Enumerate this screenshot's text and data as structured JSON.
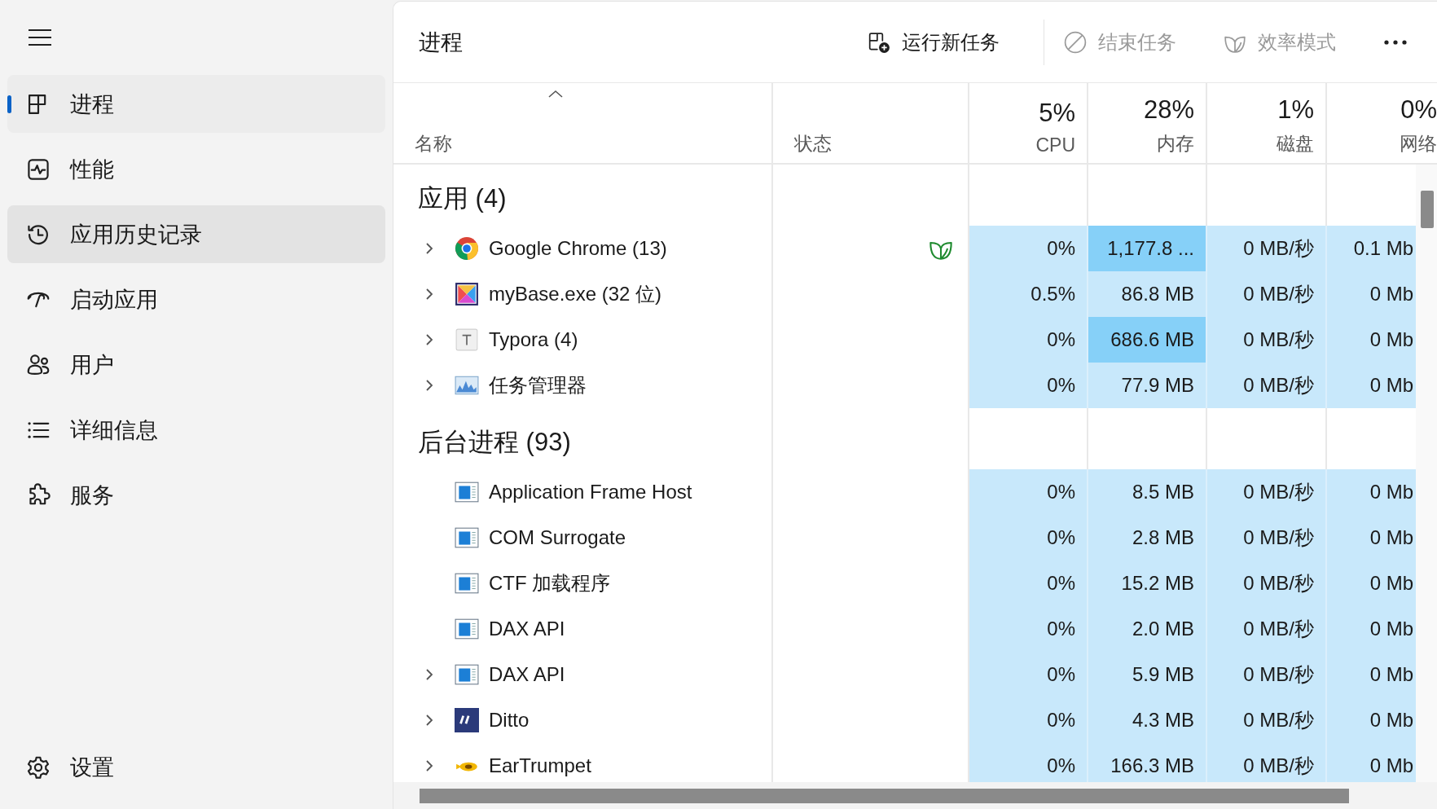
{
  "sidebar": {
    "items": [
      {
        "label": "进程",
        "selected": true,
        "hovered": false
      },
      {
        "label": "性能",
        "selected": false,
        "hovered": false
      },
      {
        "label": "应用历史记录",
        "selected": false,
        "hovered": true
      },
      {
        "label": "启动应用",
        "selected": false,
        "hovered": false
      },
      {
        "label": "用户",
        "selected": false,
        "hovered": false
      },
      {
        "label": "详细信息",
        "selected": false,
        "hovered": false
      },
      {
        "label": "服务",
        "selected": false,
        "hovered": false
      }
    ],
    "footer": {
      "label": "设置"
    }
  },
  "toolbar": {
    "title": "进程",
    "buttons": [
      {
        "label": "运行新任务",
        "disabled": false
      },
      {
        "label": "结束任务",
        "disabled": true
      },
      {
        "label": "效率模式",
        "disabled": true
      }
    ]
  },
  "table": {
    "columns": [
      {
        "label": "名称",
        "sorted": true
      },
      {
        "label": "状态",
        "sorted": false
      },
      {
        "usage": "5%",
        "label": "CPU",
        "sorted": false
      },
      {
        "usage": "28%",
        "label": "内存",
        "sorted": false
      },
      {
        "usage": "1%",
        "label": "磁盘",
        "sorted": false
      },
      {
        "usage": "0%",
        "label": "网络",
        "sorted": false
      }
    ],
    "groups": [
      {
        "title": "应用 (4)",
        "rows": [
          {
            "name": "Google Chrome (13)",
            "expandable": true,
            "efficiency_mode": true,
            "cpu": "0%",
            "memory": "1,177.8 ...",
            "memory_high": true,
            "disk": "0 MB/秒",
            "network": "0.1 Mb"
          },
          {
            "name": "myBase.exe (32 位)",
            "expandable": true,
            "efficiency_mode": false,
            "cpu": "0.5%",
            "memory": "86.8 MB",
            "memory_high": false,
            "disk": "0 MB/秒",
            "network": "0 Mb"
          },
          {
            "name": "Typora (4)",
            "expandable": true,
            "efficiency_mode": false,
            "cpu": "0%",
            "memory": "686.6 MB",
            "memory_high": true,
            "disk": "0 MB/秒",
            "network": "0 Mb"
          },
          {
            "name": "任务管理器",
            "expandable": true,
            "efficiency_mode": false,
            "cpu": "0%",
            "memory": "77.9 MB",
            "memory_high": false,
            "disk": "0 MB/秒",
            "network": "0 Mb"
          }
        ]
      },
      {
        "title": "后台进程 (93)",
        "rows": [
          {
            "name": "Application Frame Host",
            "expandable": false,
            "efficiency_mode": false,
            "cpu": "0%",
            "memory": "8.5 MB",
            "memory_high": false,
            "disk": "0 MB/秒",
            "network": "0 Mb"
          },
          {
            "name": "COM Surrogate",
            "expandable": false,
            "efficiency_mode": false,
            "cpu": "0%",
            "memory": "2.8 MB",
            "memory_high": false,
            "disk": "0 MB/秒",
            "network": "0 Mb"
          },
          {
            "name": "CTF 加载程序",
            "expandable": false,
            "efficiency_mode": false,
            "cpu": "0%",
            "memory": "15.2 MB",
            "memory_high": false,
            "disk": "0 MB/秒",
            "network": "0 Mb"
          },
          {
            "name": "DAX API",
            "expandable": false,
            "efficiency_mode": false,
            "cpu": "0%",
            "memory": "2.0 MB",
            "memory_high": false,
            "disk": "0 MB/秒",
            "network": "0 Mb"
          },
          {
            "name": "DAX API",
            "expandable": true,
            "efficiency_mode": false,
            "cpu": "0%",
            "memory": "5.9 MB",
            "memory_high": false,
            "disk": "0 MB/秒",
            "network": "0 Mb"
          },
          {
            "name": "Ditto",
            "expandable": true,
            "efficiency_mode": false,
            "cpu": "0%",
            "memory": "4.3 MB",
            "memory_high": false,
            "disk": "0 MB/秒",
            "network": "0 Mb"
          },
          {
            "name": "EarTrumpet",
            "expandable": true,
            "efficiency_mode": false,
            "cpu": "0%",
            "memory": "166.3 MB",
            "memory_high": false,
            "disk": "0 MB/秒",
            "network": "0 Mb"
          }
        ]
      }
    ]
  }
}
